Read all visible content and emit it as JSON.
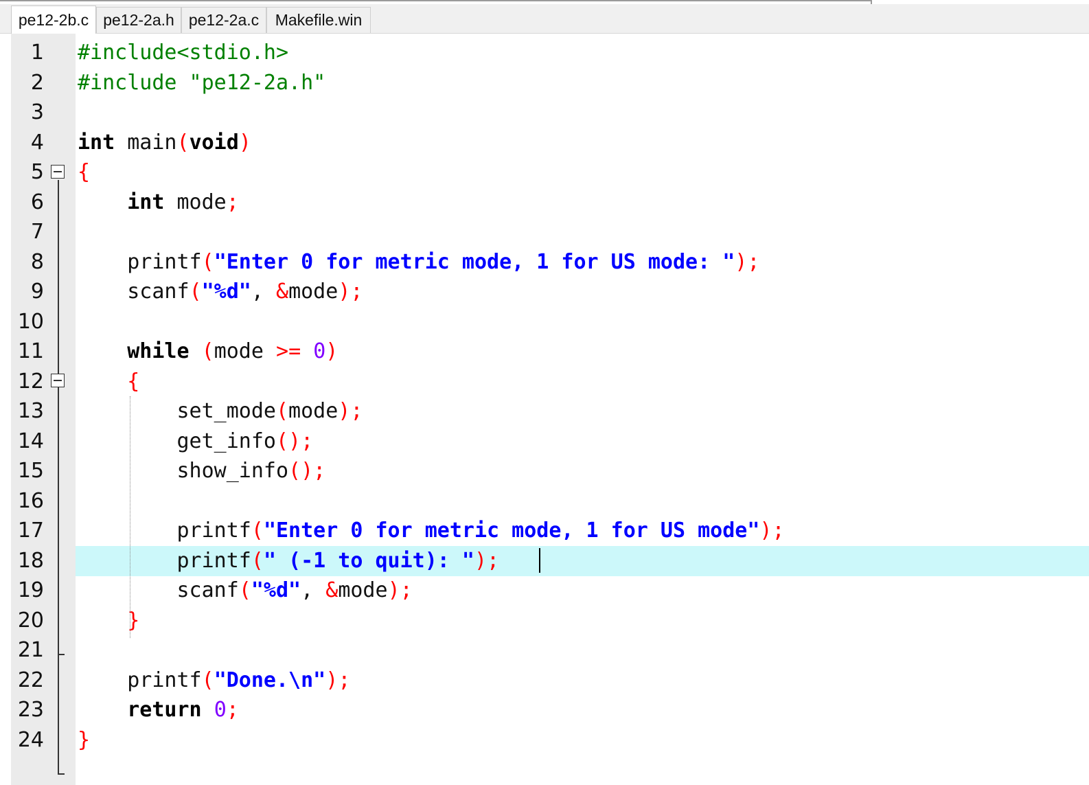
{
  "tabs": [
    {
      "label": "pe12-2b.c",
      "active": true
    },
    {
      "label": "pe12-2a.h",
      "active": false
    },
    {
      "label": "pe12-2a.c",
      "active": false
    },
    {
      "label": "Makefile.win",
      "active": false
    }
  ],
  "editor": {
    "current_line": 18,
    "lines": [
      {
        "n": "1",
        "text": "#include<stdio.h>"
      },
      {
        "n": "2",
        "text": "#include \"pe12-2a.h\""
      },
      {
        "n": "3",
        "text": ""
      },
      {
        "n": "4",
        "text": "int main(void)"
      },
      {
        "n": "5",
        "text": "{"
      },
      {
        "n": "6",
        "text": "    int mode;"
      },
      {
        "n": "7",
        "text": ""
      },
      {
        "n": "8",
        "text": "    printf(\"Enter 0 for metric mode, 1 for US mode: \");"
      },
      {
        "n": "9",
        "text": "    scanf(\"%d\", &mode);"
      },
      {
        "n": "10",
        "text": ""
      },
      {
        "n": "11",
        "text": "    while (mode >= 0)"
      },
      {
        "n": "12",
        "text": "    {"
      },
      {
        "n": "13",
        "text": "        set_mode(mode);"
      },
      {
        "n": "14",
        "text": "        get_info();"
      },
      {
        "n": "15",
        "text": "        show_info();"
      },
      {
        "n": "16",
        "text": ""
      },
      {
        "n": "17",
        "text": "        printf(\"Enter 0 for metric mode, 1 for US mode\");"
      },
      {
        "n": "18",
        "text": "        printf(\" (-1 to quit): \");"
      },
      {
        "n": "19",
        "text": "        scanf(\"%d\", &mode);"
      },
      {
        "n": "20",
        "text": "    }"
      },
      {
        "n": "21",
        "text": ""
      },
      {
        "n": "22",
        "text": "    printf(\"Done.\\n\");"
      },
      {
        "n": "23",
        "text": "    return 0;"
      },
      {
        "n": "24",
        "text": "}"
      }
    ]
  },
  "colors": {
    "preprocessor": "#008000",
    "string": "#0000ff",
    "bracket": "#ff0000",
    "number": "#8000ff",
    "current_line_bg": "#ccf8fa",
    "gutter_bg": "#ebebeb"
  }
}
